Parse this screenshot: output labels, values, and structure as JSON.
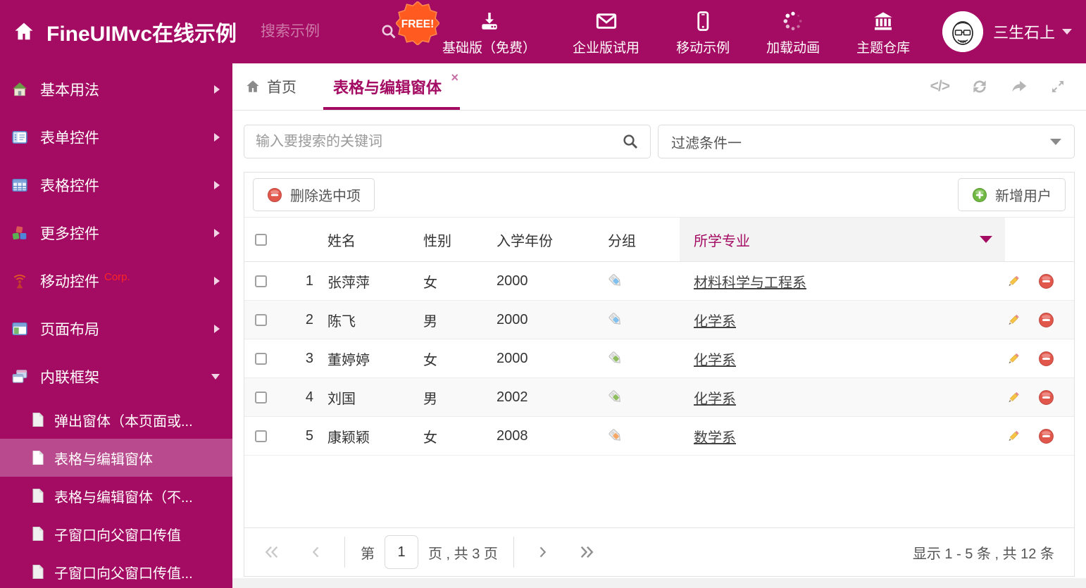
{
  "colors": {
    "accent": "#a40b62",
    "accent_light": "#b94a8d",
    "danger": "#e2574c",
    "success": "#72b944",
    "sorted_col_bg": "#f3f3f3"
  },
  "header": {
    "title": "FineUIMvc在线示例",
    "search_placeholder": "搜索示例",
    "free_badge": "FREE!",
    "nav_items": [
      {
        "label": "基础版（免费）",
        "icon": "download-icon"
      },
      {
        "label": "企业版试用",
        "icon": "envelope-icon"
      },
      {
        "label": "移动示例",
        "icon": "smartphone-icon"
      },
      {
        "label": "加载动画",
        "icon": "spinner-icon"
      },
      {
        "label": "主题仓库",
        "icon": "bank-icon"
      }
    ],
    "username": "三生石上"
  },
  "sidebar": {
    "items": [
      {
        "label": "基本用法"
      },
      {
        "label": "表单控件"
      },
      {
        "label": "表格控件"
      },
      {
        "label": "更多控件"
      },
      {
        "label": "移动控件",
        "badge": "Corp."
      },
      {
        "label": "页面布局"
      },
      {
        "label": "内联框架",
        "expanded": true
      }
    ],
    "subitems": [
      {
        "label": "弹出窗体（本页面或..."
      },
      {
        "label": "表格与编辑窗体",
        "selected": true
      },
      {
        "label": "表格与编辑窗体（不..."
      },
      {
        "label": "子窗口向父窗口传值"
      },
      {
        "label": "子窗口向父窗口传值..."
      }
    ]
  },
  "tabs": [
    {
      "label": "首页"
    },
    {
      "label": "表格与编辑窗体",
      "active": true,
      "closable": true
    }
  ],
  "filters": {
    "search_placeholder": "输入要搜索的关键词",
    "filter_value": "过滤条件一"
  },
  "toolbar": {
    "delete_label": "删除选中项",
    "add_label": "新增用户"
  },
  "grid": {
    "columns": [
      "姓名",
      "性别",
      "入学年份",
      "分组",
      "所学专业"
    ],
    "rows": [
      {
        "index": "1",
        "name": "张萍萍",
        "gender": "女",
        "year": "2000",
        "tag_color": "#7fc0ee",
        "major": "材料科学与工程系"
      },
      {
        "index": "2",
        "name": "陈飞",
        "gender": "男",
        "year": "2000",
        "tag_color": "#7fc0ee",
        "major": "化学系"
      },
      {
        "index": "3",
        "name": "董婷婷",
        "gender": "女",
        "year": "2000",
        "tag_color": "#8dbd5c",
        "major": "化学系"
      },
      {
        "index": "4",
        "name": "刘国",
        "gender": "男",
        "year": "2002",
        "tag_color": "#8dbd5c",
        "major": "化学系"
      },
      {
        "index": "5",
        "name": "康颖颖",
        "gender": "女",
        "year": "2008",
        "tag_color": "#f5a763",
        "major": "数学系"
      }
    ]
  },
  "pagination": {
    "prefix": "第",
    "current_page": "1",
    "suffix": "页 , 共 3 页",
    "summary": "显示 1 - 5 条 , 共 12 条"
  }
}
